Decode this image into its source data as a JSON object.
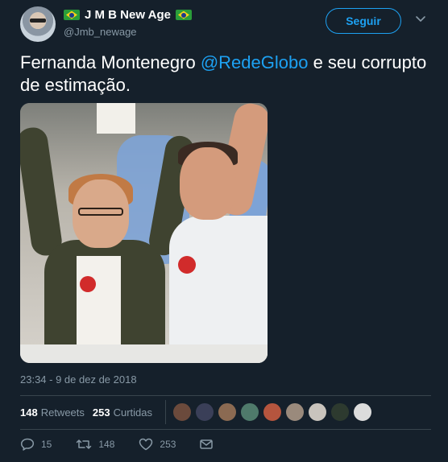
{
  "user": {
    "display_name": "J M B New Age",
    "handle": "@Jmb_newage",
    "flag_icon": "brazil-flag-icon"
  },
  "follow_button": {
    "label": "Seguir"
  },
  "tweet": {
    "text_before": "Fernanda Montenegro ",
    "mention": "@RedeGlobo",
    "text_after": "  e seu corrupto de estimação."
  },
  "timestamp": "23:34 - 9 de dez de 2018",
  "stats": {
    "retweets_count": "148",
    "retweets_label": "Retweets",
    "likes_count": "253",
    "likes_label": "Curtidas"
  },
  "likers": [
    {
      "name": "liker-avatar-1",
      "color": "#6b4a3c"
    },
    {
      "name": "liker-avatar-2",
      "color": "#3a3f58"
    },
    {
      "name": "liker-avatar-3",
      "color": "#8b6a52"
    },
    {
      "name": "liker-avatar-4",
      "color": "#4f7a6b"
    },
    {
      "name": "liker-avatar-5",
      "color": "#b5553e"
    },
    {
      "name": "liker-avatar-6",
      "color": "#9a8a7c"
    },
    {
      "name": "liker-avatar-7",
      "color": "#c9c4bd"
    },
    {
      "name": "liker-avatar-8",
      "color": "#2d3a2f"
    },
    {
      "name": "liker-avatar-9",
      "color": "#dcdcdc"
    }
  ],
  "actions": {
    "replies": "15",
    "retweets": "148",
    "likes": "253"
  },
  "colors": {
    "background": "#15202b",
    "accent": "#1da1f2",
    "muted": "#8899a6",
    "divider": "#38444d"
  }
}
